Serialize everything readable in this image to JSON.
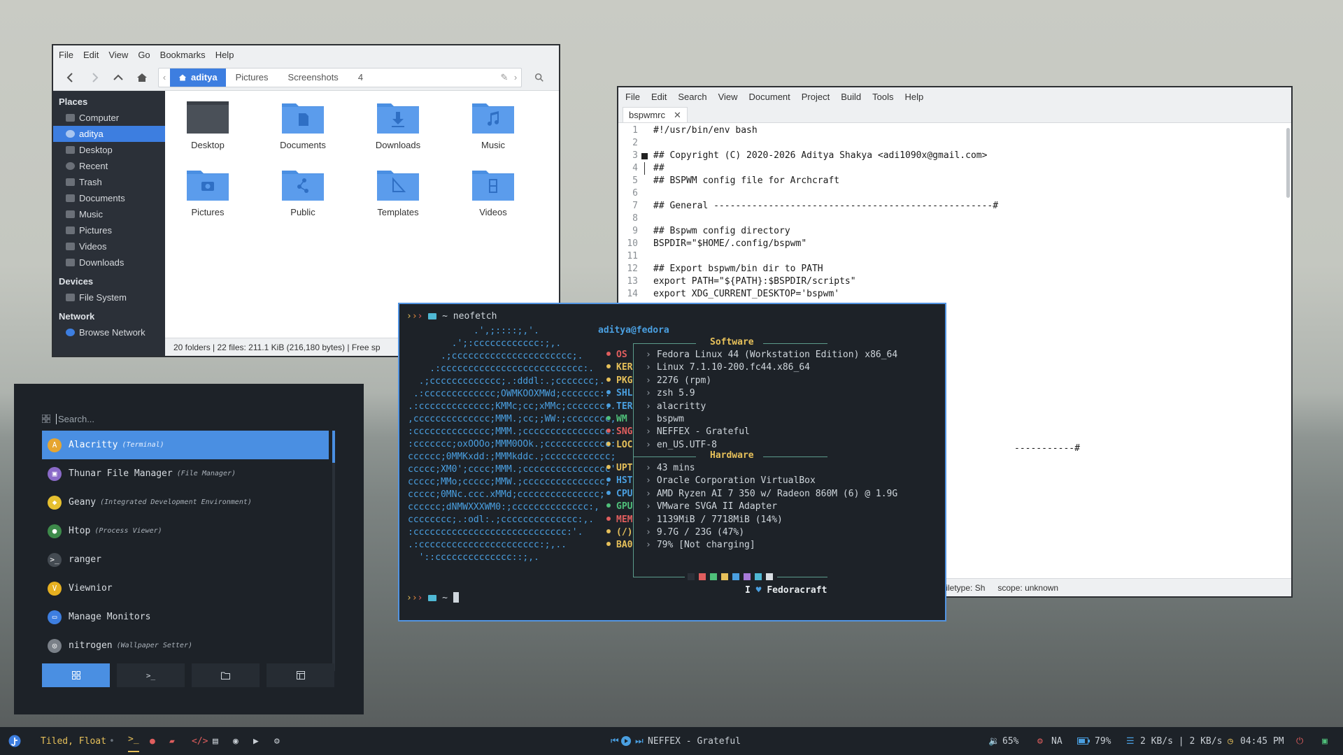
{
  "file_manager": {
    "menu": [
      "File",
      "Edit",
      "View",
      "Go",
      "Bookmarks",
      "Help"
    ],
    "breadcrumbs": [
      "aditya",
      "Pictures",
      "Screenshots",
      "4"
    ],
    "places_heading": "Places",
    "places": [
      "Computer",
      "aditya",
      "Desktop",
      "Recent",
      "Trash",
      "Documents",
      "Music",
      "Pictures",
      "Videos",
      "Downloads"
    ],
    "selected_place": "aditya",
    "devices_heading": "Devices",
    "devices": [
      "File System"
    ],
    "network_heading": "Network",
    "network": [
      "Browse Network"
    ],
    "folders": [
      "Desktop",
      "Documents",
      "Downloads",
      "Music",
      "Pictures",
      "Public",
      "Templates",
      "Videos"
    ],
    "status": "20 folders  |  22 files: 211.1 KiB (216,180 bytes)  |  Free sp"
  },
  "editor": {
    "menu": [
      "File",
      "Edit",
      "Search",
      "View",
      "Document",
      "Project",
      "Build",
      "Tools",
      "Help"
    ],
    "tab": "bspwmrc",
    "lines": [
      "#!/usr/bin/env bash",
      "",
      "## Copyright (C) 2020-2026 Aditya Shakya <adi1090x@gmail.com>",
      "##",
      "## BSPWM config file for Archcraft",
      "",
      "## General ---------------------------------------------------#",
      "",
      "## Bspwm config directory",
      "BSPDIR=\"$HOME/.config/bspwm\"",
      "",
      "## Export bspwm/bin dir to PATH",
      "export PATH=\"${PATH}:$BSPDIR/scripts\"",
      "export XDG_CURRENT_DESKTOP='bspwm'"
    ],
    "hidden_line_fragment": "-----------#",
    "status_filetype": "filetype: Sh",
    "status_scope": "scope: unknown"
  },
  "terminal": {
    "prompt_cmd": "~ neofetch",
    "prompt_home": "~",
    "userhost": "aditya@fedora",
    "software_heading": "Software",
    "hardware_heading": "Hardware",
    "software": [
      {
        "key": "OS",
        "value": "Fedora Linux 44 (Workstation Edition) x86_64",
        "color": "#e05e5e"
      },
      {
        "key": "KER",
        "value": "Linux 7.1.10-200.fc44.x86_64",
        "color": "#e6c05a"
      },
      {
        "key": "PKG",
        "value": "2276 (rpm)",
        "color": "#e6c05a"
      },
      {
        "key": "SHL",
        "value": "zsh 5.9",
        "color": "#4a9fe0"
      },
      {
        "key": "TER",
        "value": "alacritty",
        "color": "#4a9fe0"
      },
      {
        "key": "WM",
        "value": "bspwm",
        "color": "#4fc07a"
      },
      {
        "key": "SNG",
        "value": "NEFFEX - Grateful",
        "color": "#e05e5e"
      },
      {
        "key": "LOC",
        "value": "en_US.UTF-8",
        "color": "#e6c05a"
      }
    ],
    "hardware": [
      {
        "key": "UPT",
        "value": "43 mins",
        "color": "#e6c05a"
      },
      {
        "key": "HST",
        "value": "Oracle Corporation VirtualBox",
        "color": "#4a9fe0"
      },
      {
        "key": "CPU",
        "value": "AMD Ryzen AI 7 350 w/ Radeon 860M (6) @ 1.9G",
        "color": "#4a9fe0"
      },
      {
        "key": "GPU",
        "value": "VMware SVGA II Adapter",
        "color": "#4fc07a"
      },
      {
        "key": "MEM",
        "value": "1139MiB / 7718MiB (14%)",
        "color": "#e05e5e"
      },
      {
        "key": "(/)",
        "value": "9.7G / 23G (47%)",
        "color": "#e6c05a"
      },
      {
        "key": "BA0",
        "value": "79% [Not charging]",
        "color": "#e6c05a"
      }
    ],
    "palette": [
      "#2b3038",
      "#e05e5e",
      "#4fc07a",
      "#e6c05a",
      "#4a9fe0",
      "#a77ad8",
      "#4fb8d4",
      "#d8dde2"
    ],
    "footer_pre": "I",
    "footer_post": "Fedoracraft",
    "ascii": [
      "            .',;::::;,'.",
      "        .';:cccccccccccc:;,.",
      "      .;cccccccccccccccccccccc;.",
      "    .:cccccccccccccccccccccccccc:.",
      "  .;ccccccccccccc;.:dddl:.;ccccccc;.",
      " .:ccccccccccccc;OWMKOOXMWd;ccccccc:.",
      ".:ccccccccccccc;KMMc;cc;xMMc;ccccccc:.",
      ",cccccccccccccc;MMM.;cc;;WW:;cccccccc,",
      ":cccccccccccccc;MMM.;cccccccccccccccc:",
      ":ccccccc;oxOOOo;MMM0OOk.;cccccccccccc:",
      "cccccc;0MMKxdd:;MMMkddc.;cccccccccccc;",
      "ccccc;XM0';cccc;MMM.;cccccccccccccccc'",
      "ccccc;MMo;ccccc;MMW.;ccccccccccccccc;",
      "ccccc;0MNc.ccc.xMMd;ccccccccccccccc;",
      "cccccc;dNMWXXXWM0:;cccccccccccccc:,",
      "cccccccc;.:odl:.;cccccccccccccc:,.",
      ":cccccccccccccccccccccccccccc:'.",
      ".:cccccccccccccccccccccc:;,..",
      "  '::cccccccccccccc::;,."
    ]
  },
  "launcher": {
    "placeholder": "Search...",
    "items": [
      {
        "name": "Alacritty",
        "desc": "(Terminal)",
        "color": "#e6a530",
        "glyph": "A"
      },
      {
        "name": "Thunar File Manager",
        "desc": "(File Manager)",
        "color": "#8a6ac8",
        "glyph": "▣"
      },
      {
        "name": "Geany",
        "desc": "(Integrated Development Environment)",
        "color": "#e6c030",
        "glyph": "◆"
      },
      {
        "name": "Htop",
        "desc": "(Process Viewer)",
        "color": "#3d8a4a",
        "glyph": "●"
      },
      {
        "name": "ranger",
        "desc": "",
        "color": "#444b52",
        "glyph": ">_"
      },
      {
        "name": "Viewnior",
        "desc": "",
        "color": "#e6b020",
        "glyph": "V"
      },
      {
        "name": "Manage Monitors",
        "desc": "",
        "color": "#3d7ee0",
        "glyph": "▭"
      },
      {
        "name": "nitrogen",
        "desc": "(Wallpaper Setter)",
        "color": "#7a8088",
        "glyph": "◎"
      }
    ],
    "modes": [
      "grid-icon",
      "terminal-icon",
      "folder-icon",
      "window-icon"
    ]
  },
  "bar": {
    "layout": "Tiled, Float",
    "song": "NEFFEX - Grateful",
    "volume": "65%",
    "updates": "NA",
    "battery": "79%",
    "network": "2 KB/s | 2 KB/s",
    "time": "04:45 PM"
  }
}
